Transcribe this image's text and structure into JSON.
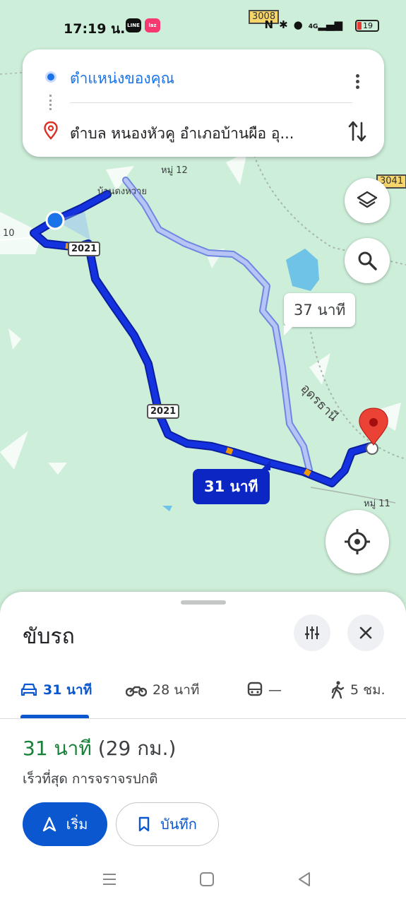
{
  "status_bar": {
    "time": "17:19 น.",
    "app_line": "LINE",
    "app_laz": "laz",
    "network": "4G",
    "battery": "19"
  },
  "search": {
    "origin": "ตำแหน่งของคุณ",
    "destination": "ตำบล หนองหัวคู อำเภอบ้านผือ อุ..."
  },
  "map": {
    "highway_labels": [
      "3008",
      "3041"
    ],
    "route_shields": [
      "2021",
      "2021"
    ],
    "place_labels": [
      "หมู่ 12",
      "บ้านดงหวาย",
      "หมู่ 11",
      "10"
    ],
    "province_label": "อุดรธานี",
    "eta_main": "31 นาที",
    "eta_alt": "37 นาที"
  },
  "sheet": {
    "title": "ขับรถ",
    "modes": [
      {
        "icon": "car-icon",
        "label": "31 นาที"
      },
      {
        "icon": "motorcycle-icon",
        "label": "28 นาที"
      },
      {
        "icon": "train-icon",
        "label": "—"
      },
      {
        "icon": "walk-icon",
        "label": "5 ชม."
      }
    ],
    "duration": "31 นาที",
    "distance": "(29 กม.)",
    "subtitle": "เร็วที่สุด การจราจรปกติ",
    "start_label": "เริ่ม",
    "save_label": "บันทึก"
  },
  "colors": {
    "route_main": "#0b26c2",
    "route_alt": "#a6b6f2",
    "accent": "#0b57d0",
    "duration_green": "#188038",
    "pin_red": "#ea4335"
  }
}
